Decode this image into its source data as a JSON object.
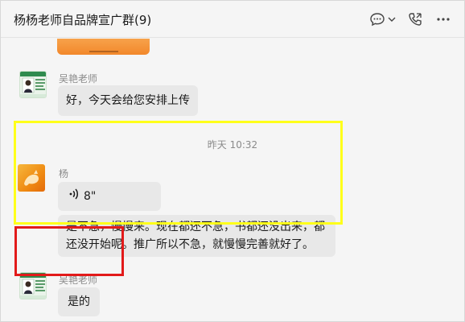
{
  "header": {
    "title": "杨杨老师自品牌宣广群(9)",
    "icons": [
      "chat-bubble-icon",
      "chevron-down-icon",
      "phone-icon",
      "more-icon"
    ]
  },
  "messages": [
    {
      "sender": "吴艳老师",
      "text": "好，今天会给您安排上传"
    },
    {
      "sender": "杨",
      "voice_duration": "8\"",
      "text_line1": "是不急，慢慢来。现在都还不急，书都还没出来，都",
      "text_line2": "还没开始呢。推广所以不急，就慢慢完善就好了。"
    },
    {
      "sender": "吴艳老师",
      "text": "是的"
    }
  ],
  "time_divider": "昨天 10:32",
  "colors": {
    "highlight_yellow": "#ffff1a",
    "highlight_red": "#e21a1a",
    "bubble": "#e8e8e8",
    "background": "#f5f5f5"
  }
}
